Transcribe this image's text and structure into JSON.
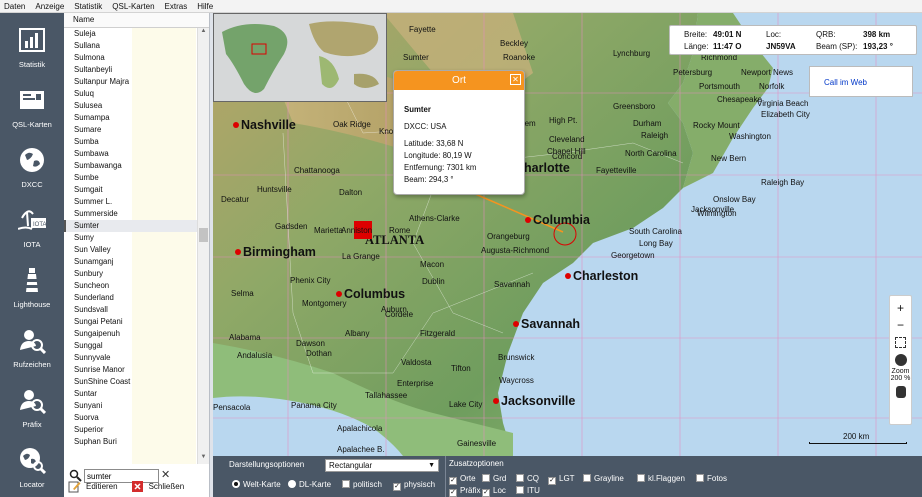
{
  "menu": [
    "Daten",
    "Anzeige",
    "Statistik",
    "QSL-Karten",
    "Extras",
    "Hilfe"
  ],
  "nav": [
    {
      "label": "Statistik",
      "icon": "chart-icon"
    },
    {
      "label": "QSL-Karten",
      "icon": "qsl-card-icon"
    },
    {
      "label": "DXCC",
      "icon": "globe-icon"
    },
    {
      "label": "IOTA",
      "icon": "island-icon"
    },
    {
      "label": "Lighthouse",
      "icon": "lighthouse-icon"
    },
    {
      "label": "Rufzeichen",
      "icon": "callsign-search-icon"
    },
    {
      "label": "Präfix",
      "icon": "prefix-search-icon"
    },
    {
      "label": "Locator",
      "icon": "locator-globe-icon"
    }
  ],
  "list": {
    "header": "Name",
    "items": [
      "Suleja",
      "Sullana",
      "Sulmona",
      "Sultanbeyli",
      "Sultanpur Majra",
      "Suluq",
      "Sulusea",
      "Sumampa",
      "Sumare",
      "Sumba",
      "Sumbawa",
      "Sumbawanga",
      "Sumbe",
      "Sumgait",
      "Summer L.",
      "Summerside",
      "Sumter",
      "Sumy",
      "Sun Valley",
      "Sunamganj",
      "Sunbury",
      "Suncheon",
      "Sunderland",
      "Sundsvall",
      "Sungai Petani",
      "Sungaipenuh",
      "Sunggal",
      "Sunnyvale",
      "Sunrise Manor",
      "SunShine Coast",
      "Suntar",
      "Sunyani",
      "Suorva",
      "Superior",
      "Suphan Buri"
    ],
    "selected": "Sumter",
    "search_value": "sumter",
    "edit_label": "Editieren",
    "close_label": "Schließen"
  },
  "popup": {
    "title": "Ort",
    "name": "Sumter",
    "dxcc": "DXCC: USA",
    "lat": "Latitude: 33,68 N",
    "lon": "Longitude: 80,19 W",
    "dist": "Entfernung: 7301 km",
    "beam": "Beam: 294,3 °"
  },
  "info": {
    "breite_label": "Breite:",
    "breite": "49:01 N",
    "laenge_label": "Länge:",
    "laenge": "11:47 O",
    "loc_label": "Loc:",
    "loc": "JN59VA",
    "qrb_label": "QRB:",
    "qrb": "398 km",
    "beam_label": "Beam (SP):",
    "beam": "193,23 °"
  },
  "call_link": "Call im Web",
  "zoom": {
    "label": "Zoom",
    "value": "200 %"
  },
  "scale": "200 km",
  "map_labels": {
    "big": [
      {
        "t": "Nashville"
      },
      {
        "t": "Birmingham"
      },
      {
        "t": "ATLANTA"
      },
      {
        "t": "Columbus"
      },
      {
        "t": "Columbia"
      },
      {
        "t": "Charleston"
      },
      {
        "t": "Savannah"
      },
      {
        "t": "Jacksonville"
      },
      {
        "t": "Charlotte"
      }
    ],
    "small": [
      "Fayette",
      "Beckley",
      "Roanoke",
      "Lynchburg",
      "Richmond",
      "Petersburg",
      "Newport News",
      "Portsmouth",
      "Norfolk",
      "Chesapeake",
      "Elizabeth City",
      "Virginia Beach",
      "Greensboro",
      "Raleigh",
      "Rocky Mount",
      "Washington",
      "Oak Ridge",
      "Knoxville",
      "Asheville",
      "Concord",
      "High Pt.",
      "Durham",
      "Fayetteville",
      "North Carolina",
      "New Bern",
      "Jacksonville",
      "Wilmington",
      "Raleigh Bay",
      "Onslow Bay",
      "Long Bay",
      "Georgetown",
      "South Carolina",
      "Orangeburg",
      "Augusta-Richmond",
      "Athens-Clarke",
      "Dalton",
      "Chattanooga",
      "Huntsville",
      "Decatur",
      "Gadsden",
      "Anniston",
      "Rome",
      "Marietta",
      "La Grange",
      "Macon",
      "Dublin",
      "Savannah",
      "Phenix City",
      "Selma",
      "Montgomery",
      "Auburn",
      "Cordele",
      "Albany",
      "Valdosta",
      "Tallahassee",
      "Panama City",
      "Apalachicola",
      "Apalachee B.",
      "Lake City",
      "Gainesville",
      "Dothan",
      "Enterprise",
      "Pensacola",
      "Brunswick",
      "Fitzgerald",
      "Tifton",
      "Waycross",
      "Andalusia",
      "Alabama",
      "Dawson",
      "Sumter",
      "Salem",
      "Cleveland",
      "Salisbury",
      "Chapel Hill"
    ]
  },
  "bottom": {
    "darst_title": "Darstellungsoptionen",
    "projection": "Rectangular",
    "welt": "Welt-Karte",
    "dl": "DL-Karte",
    "politisch": "politisch",
    "physisch": "physisch",
    "zusatz_title": "Zusatzoptionen",
    "opts": [
      {
        "label": "Orte",
        "checked": true
      },
      {
        "label": "Grd",
        "checked": false
      },
      {
        "label": "CQ",
        "checked": false
      },
      {
        "label": "LGT",
        "checked": true
      },
      {
        "label": "Grayline",
        "checked": false
      },
      {
        "label": "kl.Flaggen",
        "checked": false
      },
      {
        "label": "Fotos",
        "checked": false
      },
      {
        "label": "Präfix",
        "checked": true
      },
      {
        "label": "Loc",
        "checked": true
      },
      {
        "label": "ITU",
        "checked": false
      }
    ]
  },
  "colors": {
    "sidebar": "#4a5766",
    "accent": "#f5941f",
    "link": "#0037c8"
  }
}
